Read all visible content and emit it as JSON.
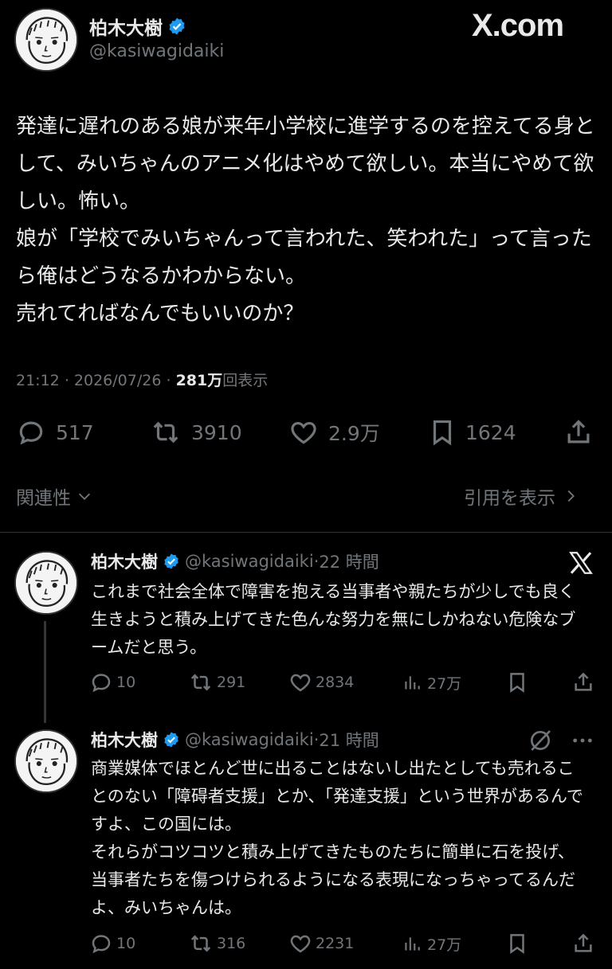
{
  "watermark": "X.com",
  "main_tweet": {
    "author_name": "柏木大樹",
    "handle": "@kasiwagidaiki",
    "text": "発達に遅れのある娘が来年小学校に進学するのを控えてる身として、みいちゃんのアニメ化はやめて欲しい。本当にやめて欲しい。怖い。\n娘が「学校でみいちゃんって言われた、笑われた」って言ったら俺はどうなるかわからない。\n売れてればなんでもいいのか？",
    "time": "21:12",
    "date": "2026/07/26",
    "views_count": "281万",
    "views_label": "回表示",
    "replies": "517",
    "reposts": "3910",
    "likes": "2.9万",
    "bookmarks": "1624"
  },
  "related_label": "関連性",
  "quotes_label": "引用を表示",
  "replies": [
    {
      "author_name": "柏木大樹",
      "handle": "@kasiwagidaiki",
      "time_ago": "22 時間",
      "text": "これまで社会全体で障害を抱える当事者や親たちが少しでも良く生きようと積み上げてきた色んな努力を無にしかねない危険なブームだと思う。",
      "replies": "10",
      "reposts": "291",
      "likes": "2834",
      "views": "27万"
    },
    {
      "author_name": "柏木大樹",
      "handle": "@kasiwagidaiki",
      "time_ago": "21 時間",
      "text": "商業媒体でほとんど世に出ることはないし出たとしても売れることのない「障碍者支援」とか、「発達支援」という世界があるんですよ、この国には。\nそれらがコツコツと積み上げてきたものたちに簡単に石を投げ、当事者たちを傷つけられるようになる表現になっちゃってるんだよ、みいちゃんは。",
      "replies": "10",
      "reposts": "316",
      "likes": "2231",
      "views": "27万"
    }
  ],
  "colors": {
    "background": "#000000",
    "text": "#e7e9ea",
    "secondary": "#71767b",
    "verified": "#1d9bf0"
  }
}
